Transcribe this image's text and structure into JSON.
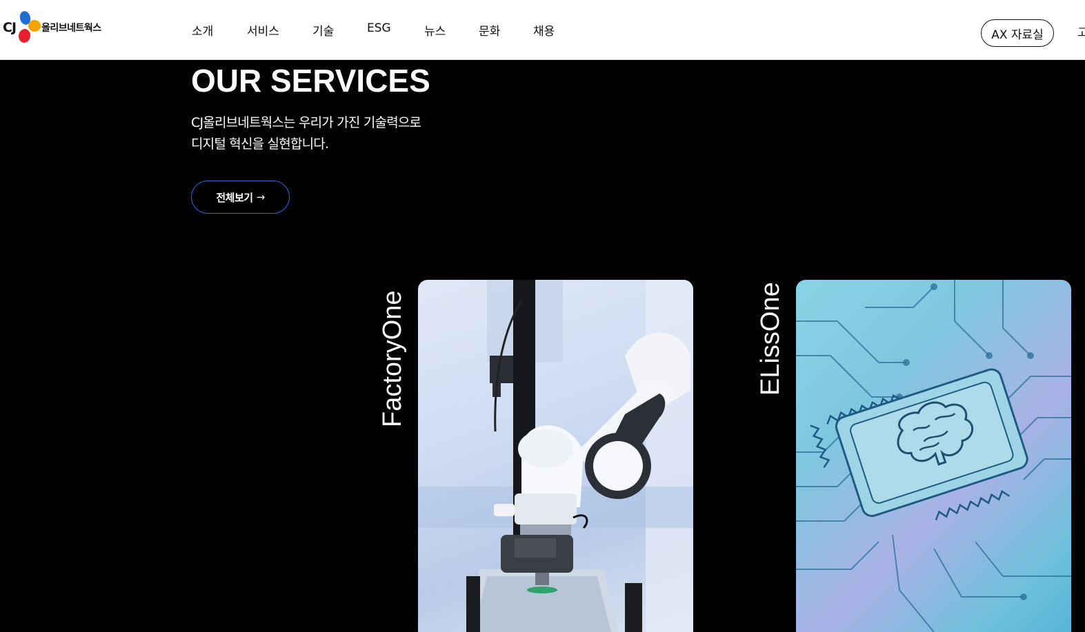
{
  "header": {
    "logo_cj": "CJ",
    "logo_text": "올리브네트웍스",
    "nav": [
      "소개",
      "서비스",
      "기술",
      "ESG",
      "뉴스",
      "문화",
      "채용"
    ],
    "ax_button": "AX 자료실",
    "cut_item": "고"
  },
  "hero": {
    "title": "OUR SERVICES",
    "desc_line1": "CJ올리브네트웍스는 우리가 가진 기술력으로",
    "desc_line2": "디지털 혁신을 실현합니다.",
    "view_all_label": "전체보기",
    "view_all_arrow": "→"
  },
  "services": [
    {
      "label": "FactoryOne",
      "icon": "robot-arm-image"
    },
    {
      "label": "ELissOne",
      "icon": "ai-chip-brain-image"
    }
  ],
  "colors": {
    "accent": "#1e6be6",
    "logo_blue": "#1f6fd1",
    "logo_orange": "#f5a300",
    "logo_red": "#e81f2d"
  }
}
